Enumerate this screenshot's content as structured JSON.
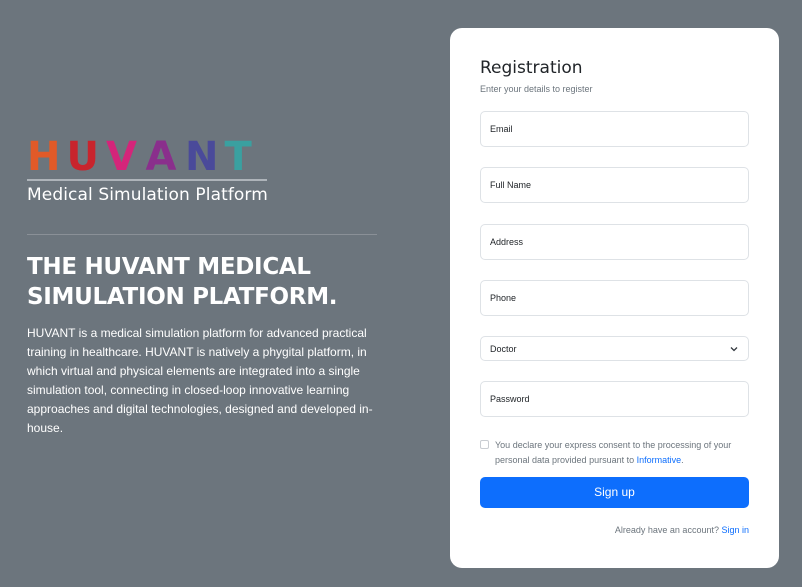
{
  "brand": {
    "logo_letters": [
      {
        "char": "H",
        "color": "#e15a28"
      },
      {
        "char": "U",
        "color": "#c8242d"
      },
      {
        "char": "V",
        "color": "#d4257a"
      },
      {
        "char": "A",
        "color": "#8a2f8c"
      },
      {
        "char": "N",
        "color": "#4a4a9a"
      },
      {
        "char": "T",
        "color": "#3aa0a0"
      }
    ],
    "tagline": "Medical Simulation Platform"
  },
  "headline": "THE HUVANT MEDICAL SIMULATION PLATFORM.",
  "description": "HUVANT is a medical simulation platform for advanced practical training in healthcare. HUVANT is natively a phygital platform, in which virtual and physical elements are integrated into a single simulation tool, connecting in closed-loop innovative learning approaches and digital technologies, designed and developed in-house.",
  "form": {
    "title": "Registration",
    "subtitle": "Enter your details to register",
    "email_label": "Email",
    "fullname_label": "Full Name",
    "address_label": "Address",
    "phone_label": "Phone",
    "role_selected": "Doctor",
    "password_label": "Password",
    "consent_text": "You declare your express consent to the processing of your personal data provided pursuant to ",
    "consent_link": "Informative",
    "consent_end": ".",
    "submit_label": "Sign up",
    "have_account": "Already have an account? ",
    "signin_link": "Sign in"
  },
  "colors": {
    "background": "#6c757d",
    "accent": "#0d6efd"
  }
}
